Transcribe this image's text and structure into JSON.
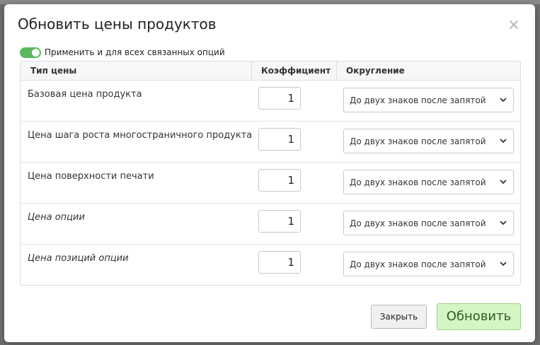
{
  "dialog": {
    "title": "Обновить цены продуктов",
    "close_symbol": "×"
  },
  "toggle": {
    "label": "Применить и для всех связанных опций",
    "checked": true,
    "color": "#5cb85c"
  },
  "table": {
    "headers": {
      "price_type": "Тип цены",
      "coefficient": "Коэффициент",
      "rounding": "Округление"
    },
    "rows": [
      {
        "label": "Базовая цена продукта",
        "italic": false,
        "coefficient": "1",
        "rounding": "До двух знаков после запятой"
      },
      {
        "label": "Цена шага роста многостраничного продукта",
        "italic": false,
        "coefficient": "1",
        "rounding": "До двух знаков после запятой"
      },
      {
        "label": "Цена поверхности печати",
        "italic": false,
        "coefficient": "1",
        "rounding": "До двух знаков после запятой"
      },
      {
        "label": "Цена опции",
        "italic": true,
        "coefficient": "1",
        "rounding": "До двух знаков после запятой"
      },
      {
        "label": "Цена позиций опции",
        "italic": true,
        "coefficient": "1",
        "rounding": "До двух знаков после запятой"
      }
    ]
  },
  "footer": {
    "close_label": "Закрыть",
    "update_label": "Обновить",
    "update_color": "#d6f5c4"
  },
  "icons": {
    "dropdown": "chevron-down-icon",
    "close": "close-icon"
  }
}
